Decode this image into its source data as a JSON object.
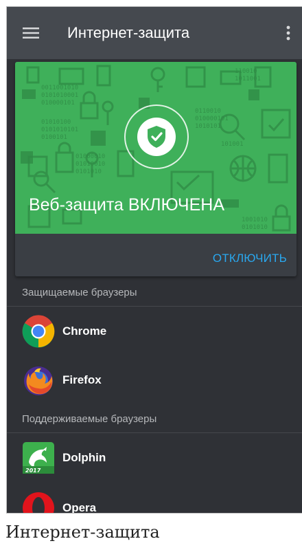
{
  "appbar": {
    "title": "Интернет-защита",
    "menu_icon": "hamburger-menu-icon",
    "more_icon": "more-vertical-icon"
  },
  "protection_card": {
    "status": "Веб-защита ВКЛЮЧЕНА",
    "icon": "shield-check-icon",
    "disable_button": "ОТКЛЮЧИТЬ",
    "hero_color": "#3fb05a",
    "accent_color": "#29a8f0"
  },
  "protected_browsers": {
    "header": "Защищаемые браузеры",
    "items": [
      {
        "name": "Chrome",
        "icon": "chrome-icon"
      },
      {
        "name": "Firefox",
        "icon": "firefox-icon"
      }
    ]
  },
  "supported_browsers": {
    "header": "Поддерживаемые браузеры",
    "items": [
      {
        "name": "Dolphin",
        "icon": "dolphin-icon",
        "badge": "2017"
      },
      {
        "name": "Opera",
        "icon": "opera-icon"
      }
    ]
  },
  "caption": "Интернет-защита"
}
